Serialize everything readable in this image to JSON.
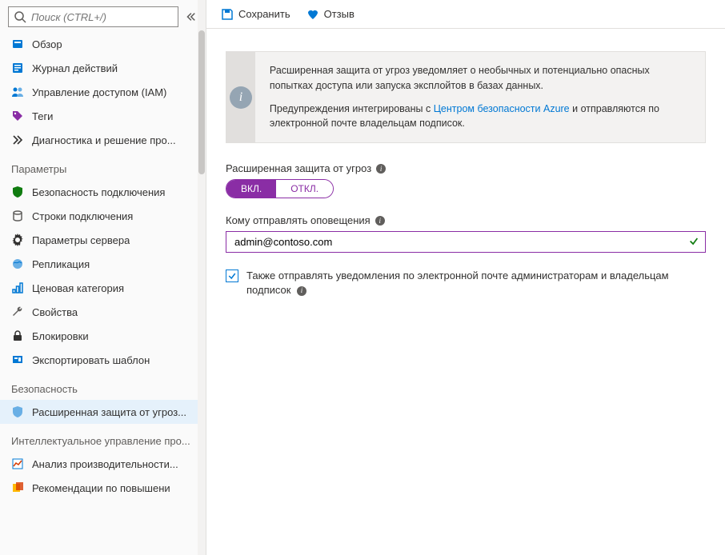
{
  "search": {
    "placeholder": "Поиск (CTRL+/)"
  },
  "sidebar": {
    "items_top": [
      {
        "label": "Обзор",
        "icon": "overview"
      },
      {
        "label": "Журнал действий",
        "icon": "activitylog"
      },
      {
        "label": "Управление доступом (IAM)",
        "icon": "iam"
      },
      {
        "label": "Теги",
        "icon": "tags"
      },
      {
        "label": "Диагностика и решение про...",
        "icon": "diagnose"
      }
    ],
    "section_params": "Параметры",
    "items_params": [
      {
        "label": "Безопасность подключения",
        "icon": "connsec"
      },
      {
        "label": "Строки подключения",
        "icon": "connstr"
      },
      {
        "label": "Параметры сервера",
        "icon": "serverparams"
      },
      {
        "label": "Репликация",
        "icon": "replication"
      },
      {
        "label": "Ценовая категория",
        "icon": "pricing"
      },
      {
        "label": "Свойства",
        "icon": "properties"
      },
      {
        "label": "Блокировки",
        "icon": "locks"
      },
      {
        "label": "Экспортировать шаблон",
        "icon": "export"
      }
    ],
    "section_security": "Безопасность",
    "items_security": [
      {
        "label": "Расширенная защита от угроз...",
        "icon": "atp",
        "active": true
      }
    ],
    "section_ai": "Интеллектуальное управление про...",
    "items_ai": [
      {
        "label": "Анализ производительности...",
        "icon": "perf"
      },
      {
        "label": "Рекомендации по повышени",
        "icon": "rec"
      }
    ]
  },
  "toolbar": {
    "save": "Сохранить",
    "feedback": "Отзыв"
  },
  "info": {
    "p1": "Расширенная защита от угроз уведомляет о необычных и потенциально опасных попытках доступа или запуска эксплойтов в базах данных.",
    "p2a": "Предупреждения интегрированы с ",
    "p2link": "Центром безопасности Azure",
    "p2b": " и отправляются по электронной почте владельцам подписок."
  },
  "atp_label": "Расширенная защита от угроз",
  "toggle": {
    "on": "ВКЛ.",
    "off": "ОТКЛ."
  },
  "alerts_to_label": "Кому отправлять оповещения",
  "alerts_to_value": "admin@contoso.com",
  "notify_admins_label": "Также отправлять уведомления по электронной почте администраторам и владельцам подписок",
  "colors": {
    "accent": "#8a2da5",
    "link": "#0078d4",
    "success": "#107c10"
  }
}
